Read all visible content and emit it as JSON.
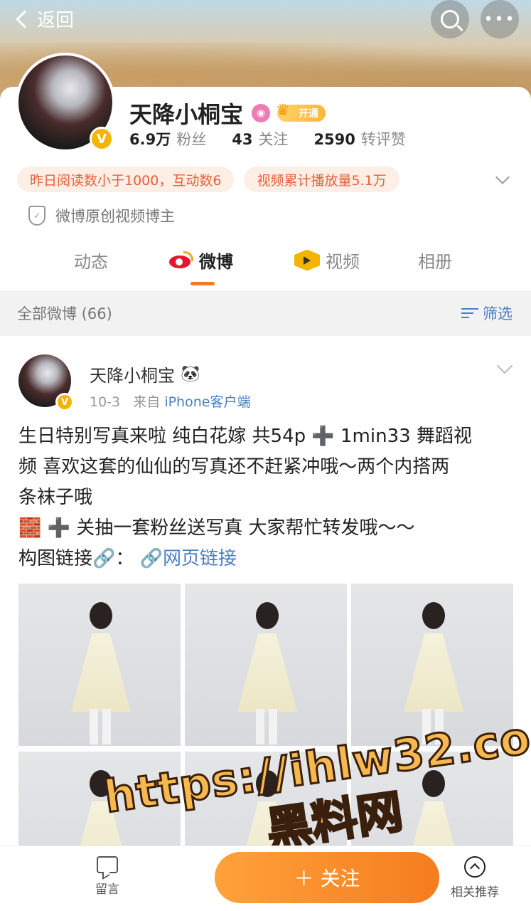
{
  "nav": {
    "back_label": "返回"
  },
  "profile": {
    "name": "天降小桐宝",
    "vip_label": "开通",
    "stats": [
      {
        "value": "6.9万",
        "label": "粉丝"
      },
      {
        "value": "43",
        "label": "关注"
      },
      {
        "value": "2590",
        "label": "转评赞"
      }
    ],
    "tags": [
      "昨日阅读数小于1000，互动数6",
      "视频累计播放量5.1万"
    ],
    "certification": "微博原创视频博主",
    "tabs": [
      "动态",
      "微博",
      "视频",
      "相册"
    ],
    "active_tab": "微博"
  },
  "filter": {
    "left_label": "全部微博 (66)",
    "right_label": "筛选"
  },
  "post": {
    "author": "天降小桐宝",
    "author_emoji": "🐼",
    "date": "10-3",
    "from_prefix": "来自",
    "source": "iPhone客户端",
    "lines": [
      "生日特别写真来啦 纯白花嫁 共54p ➕ 1min33 舞蹈视",
      "频 喜欢这套的仙仙的写真还不赶紧冲哦～两个内搭两",
      "条袜子哦",
      "🧱 ➕ 关抽一套粉丝送写真 大家帮忙转发哦～～"
    ],
    "link_prefix": "构图链接🔗：",
    "link_text": "🔗网页链接",
    "photo_count": 6
  },
  "watermark": {
    "line1": "https://ihlw32.com",
    "line2": "黑料网"
  },
  "bottom_bar": {
    "comment_label": "留言",
    "follow_label": "＋ 关注",
    "recommend_label": "相关推荐"
  },
  "colors": {
    "accent": "#f47b20",
    "link": "#4a7fc1",
    "tag_text": "#e8603c",
    "tag_bg": "#fdeee6"
  }
}
